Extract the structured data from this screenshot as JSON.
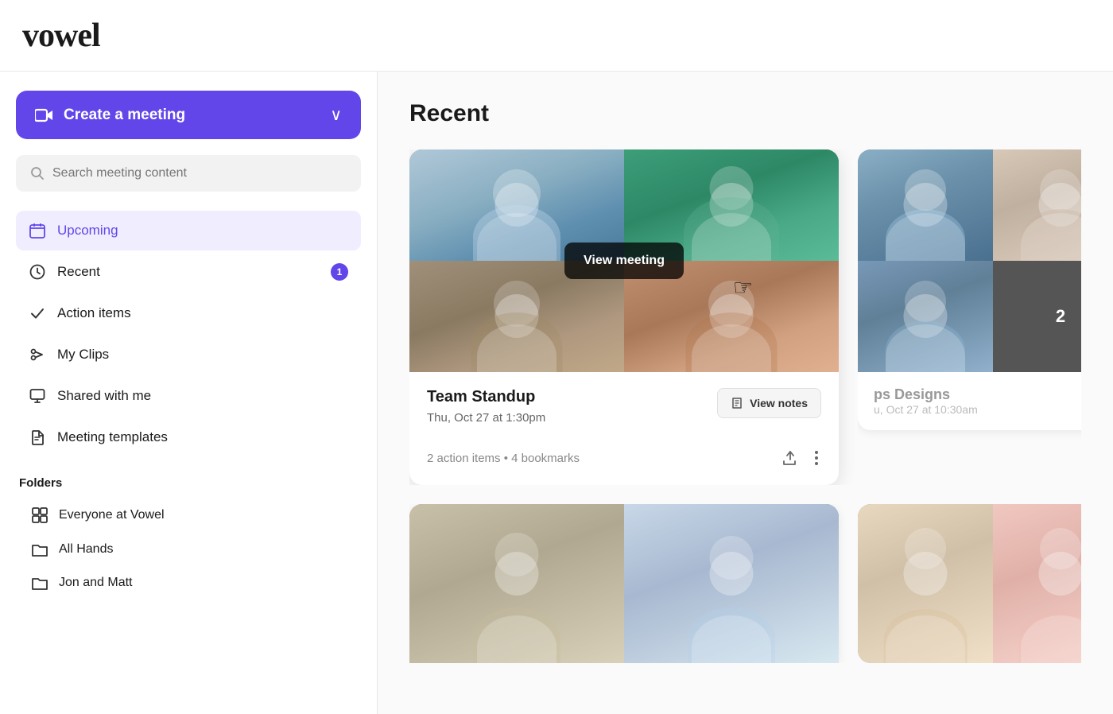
{
  "app": {
    "logo": "vowel"
  },
  "sidebar": {
    "create_button_label": "Create a meeting",
    "search_placeholder": "Search meeting content",
    "nav_items": [
      {
        "id": "upcoming",
        "label": "Upcoming",
        "icon": "calendar",
        "active": true,
        "badge": null
      },
      {
        "id": "recent",
        "label": "Recent",
        "icon": "clock",
        "active": false,
        "badge": "1"
      },
      {
        "id": "action-items",
        "label": "Action items",
        "icon": "check",
        "active": false,
        "badge": null
      },
      {
        "id": "my-clips",
        "label": "My Clips",
        "icon": "scissors",
        "active": false,
        "badge": null
      },
      {
        "id": "shared-with-me",
        "label": "Shared with me",
        "icon": "monitor",
        "active": false,
        "badge": null
      },
      {
        "id": "meeting-templates",
        "label": "Meeting templates",
        "icon": "file",
        "active": false,
        "badge": null
      }
    ],
    "folders_title": "Folders",
    "folders": [
      {
        "id": "everyone",
        "label": "Everyone at Vowel",
        "icon": "grid"
      },
      {
        "id": "all-hands",
        "label": "All Hands",
        "icon": "folder"
      },
      {
        "id": "jon-and-matt",
        "label": "Jon and Matt",
        "icon": "folder"
      }
    ]
  },
  "main": {
    "section_title": "Recent",
    "meeting_cards": [
      {
        "id": "card1",
        "title": "Team Standup",
        "datetime": "Thu, Oct 27 at 1:30pm",
        "meta": "2 action items • 4 bookmarks",
        "view_notes_label": "View notes",
        "view_meeting_label": "View meeting",
        "show_overlay": true
      },
      {
        "id": "card2",
        "title": "ps Designs",
        "datetime": "u, Oct 27 at 10:30am",
        "meta": "",
        "partial": true,
        "badge_count": "2"
      }
    ]
  },
  "icons": {
    "search": "🔍",
    "calendar": "📅",
    "clock": "🕐",
    "check": "✓",
    "scissors": "✂",
    "monitor": "🖥",
    "file": "📄",
    "grid": "⊞",
    "folder": "📁",
    "notes": "📄",
    "share": "↗",
    "more": "⋮",
    "chevron_down": "⌄",
    "video": "📹"
  }
}
